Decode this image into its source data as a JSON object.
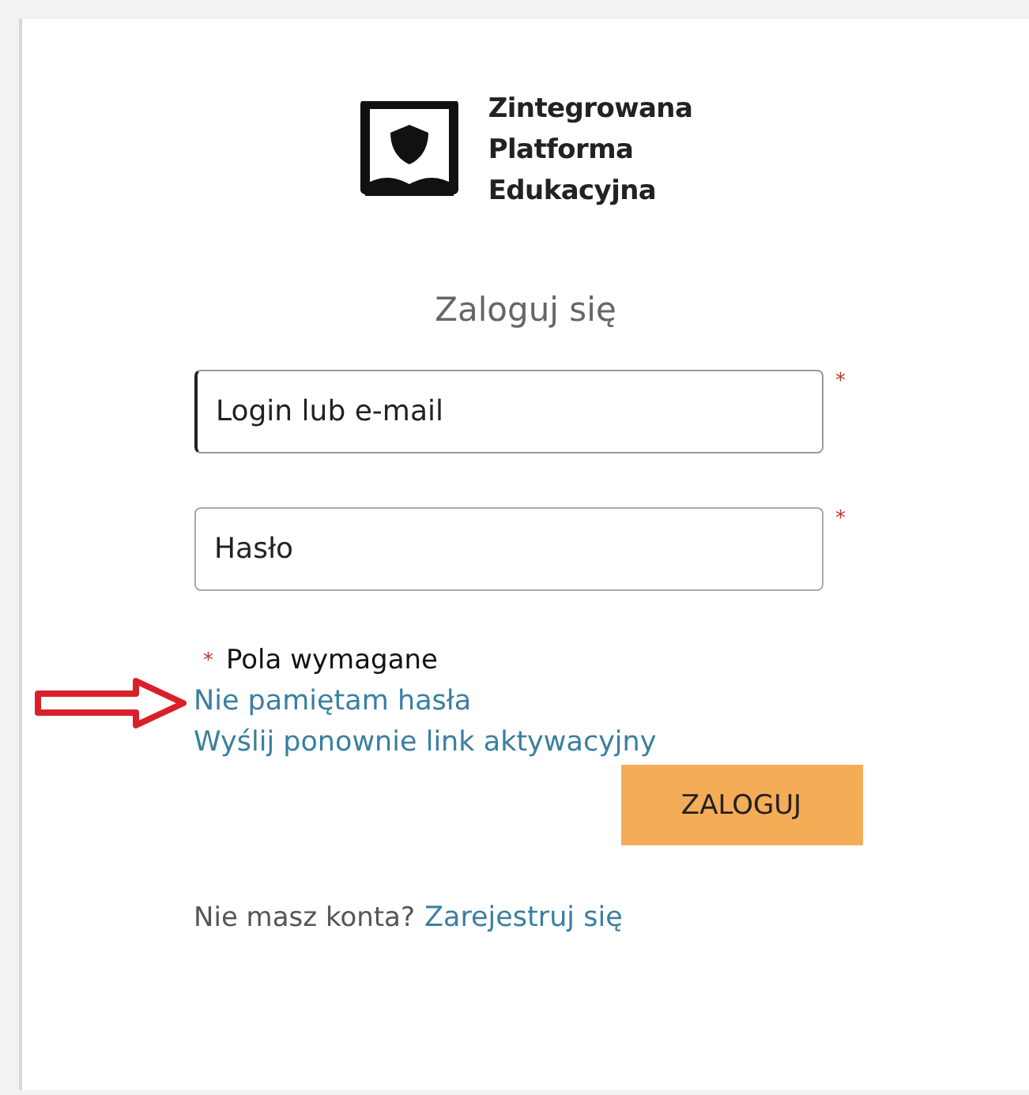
{
  "logo": {
    "lines": [
      "Zintegrowana",
      "Platforma",
      "Edukacyjna"
    ]
  },
  "heading": "Zaloguj się",
  "fields": [
    {
      "placeholder": "Login lub e-mail",
      "required_mark": "*",
      "focused": true
    },
    {
      "placeholder": "Hasło",
      "required_mark": "*",
      "focused": false
    }
  ],
  "required_note": {
    "mark": "*",
    "text": "Pola wymagane"
  },
  "links": [
    {
      "label": "Nie pamiętam hasła",
      "annotated": true
    },
    {
      "label": "Wyślij ponownie link aktywacyjny",
      "annotated": false
    }
  ],
  "submit_button": "ZALOGUJ",
  "register": {
    "prompt": "Nie masz konta?",
    "link": "Zarejestruj się"
  }
}
